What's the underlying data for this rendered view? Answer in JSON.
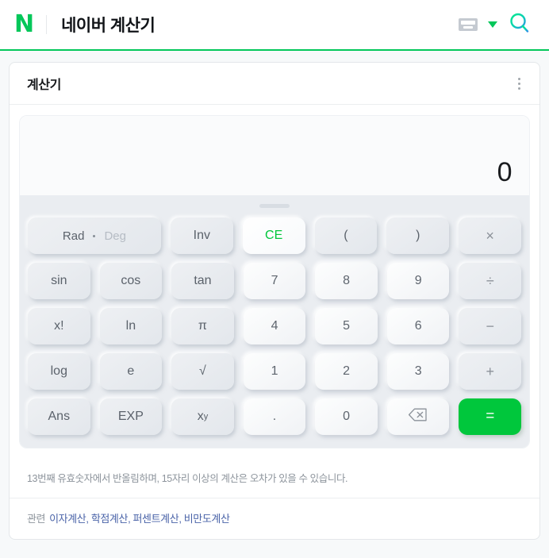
{
  "header": {
    "logo": "N",
    "title": "네이버 계산기",
    "keyboard_icon": "keyboard-icon",
    "dropdown_icon": "chevron-down-icon",
    "search_icon": "search-icon",
    "accent_color": "#03c75a"
  },
  "card": {
    "title": "계산기",
    "menu_icon": "kebab-menu-icon"
  },
  "display": {
    "value": "0"
  },
  "keypad": {
    "rows": [
      [
        {
          "label": "Rad",
          "label2": "Deg",
          "type": "toggle",
          "name": "rad-deg-toggle",
          "span": 2
        },
        {
          "label": "Inv",
          "type": "func",
          "name": "inv-button"
        },
        {
          "label": "CE",
          "type": "ce",
          "name": "clear-entry-button"
        },
        {
          "label": "(",
          "type": "func",
          "name": "open-paren-button"
        },
        {
          "label": ")",
          "type": "func",
          "name": "close-paren-button"
        },
        {
          "label": "×",
          "type": "op",
          "name": "multiply-button"
        }
      ],
      [
        {
          "label": "sin",
          "type": "func",
          "name": "sin-button"
        },
        {
          "label": "cos",
          "type": "func",
          "name": "cos-button"
        },
        {
          "label": "tan",
          "type": "func",
          "name": "tan-button"
        },
        {
          "label": "7",
          "type": "num",
          "name": "digit-7-button"
        },
        {
          "label": "8",
          "type": "num",
          "name": "digit-8-button"
        },
        {
          "label": "9",
          "type": "num",
          "name": "digit-9-button"
        },
        {
          "label": "÷",
          "type": "op",
          "name": "divide-button"
        }
      ],
      [
        {
          "label": "x!",
          "type": "func",
          "name": "factorial-button"
        },
        {
          "label": "ln",
          "type": "func",
          "name": "ln-button"
        },
        {
          "label": "π",
          "type": "func",
          "name": "pi-button"
        },
        {
          "label": "4",
          "type": "num",
          "name": "digit-4-button"
        },
        {
          "label": "5",
          "type": "num",
          "name": "digit-5-button"
        },
        {
          "label": "6",
          "type": "num",
          "name": "digit-6-button"
        },
        {
          "label": "−",
          "type": "op",
          "name": "minus-button"
        }
      ],
      [
        {
          "label": "log",
          "type": "func",
          "name": "log-button"
        },
        {
          "label": "e",
          "type": "func",
          "name": "e-button"
        },
        {
          "label": "√",
          "type": "func",
          "name": "sqrt-button"
        },
        {
          "label": "1",
          "type": "num",
          "name": "digit-1-button"
        },
        {
          "label": "2",
          "type": "num",
          "name": "digit-2-button"
        },
        {
          "label": "3",
          "type": "num",
          "name": "digit-3-button"
        },
        {
          "label": "+",
          "type": "op",
          "name": "plus-button"
        }
      ],
      [
        {
          "label": "Ans",
          "type": "func",
          "name": "answer-button"
        },
        {
          "label": "EXP",
          "type": "func",
          "name": "exp-button"
        },
        {
          "label": "x",
          "sup": "y",
          "type": "func",
          "name": "power-button"
        },
        {
          "label": ".",
          "type": "num",
          "name": "decimal-point-button"
        },
        {
          "label": "0",
          "type": "num",
          "name": "digit-0-button"
        },
        {
          "label": "backspace-icon",
          "type": "backspace",
          "name": "backspace-button"
        },
        {
          "label": "=",
          "type": "equals",
          "name": "equals-button"
        }
      ]
    ],
    "rad_deg": {
      "active": "Rad",
      "inactive": "Deg"
    }
  },
  "footer": {
    "note": "13번째 유효숫자에서 반올림하며, 15자리 이상의 계산은 오차가 있을 수 있습니다.",
    "related_label": "관련",
    "related_links": [
      "이자계산",
      "학점계산",
      "퍼센트계산",
      "비만도계산"
    ]
  }
}
